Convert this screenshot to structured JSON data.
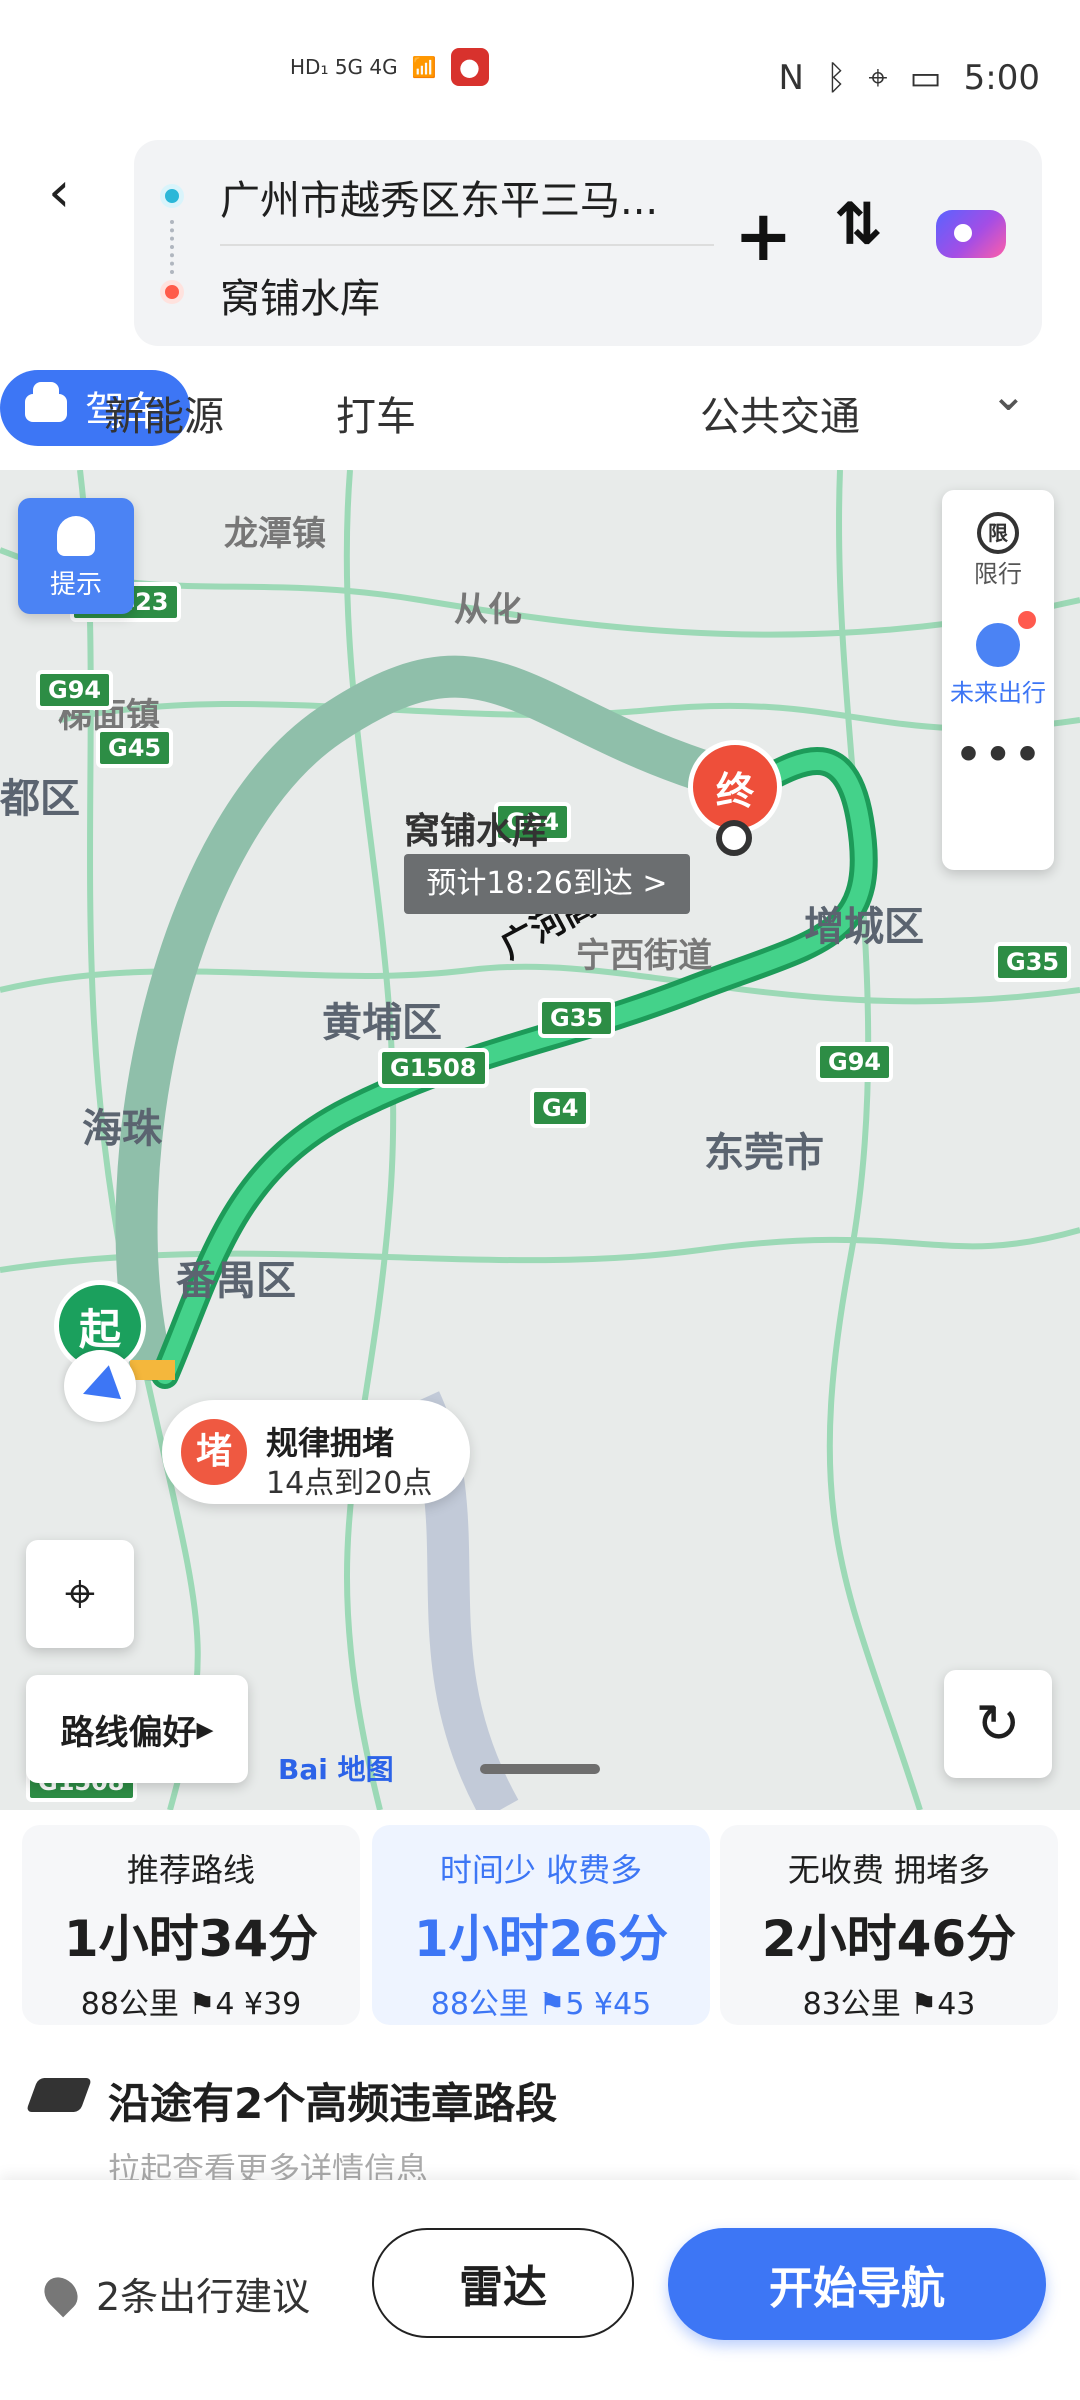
{
  "status": {
    "network": "HD₁ 5G 4G",
    "time": "5:00"
  },
  "search": {
    "from": "广州市越秀区东平三马...",
    "to": "窝铺水库"
  },
  "tabs": [
    "新能源",
    "打车",
    "驾车",
    "公共交通"
  ],
  "map": {
    "alert": "提示",
    "limit": "限行",
    "limit_icon": "限",
    "future": "未来出行",
    "destination": "窝铺水库",
    "eta": "预计18:26到达 >",
    "start": "起",
    "end": "终",
    "traffic_icon": "堵",
    "traffic_title": "规律拥堵",
    "traffic_time": "14点到20点",
    "route_pref": "路线偏好",
    "logo_baidu": "Bai",
    "logo_map": "地图",
    "labels": [
      "龙潭镇",
      "从化",
      "梯面镇",
      "都区",
      "黄埔区",
      "宁西街道",
      "增城区",
      "海珠",
      "东莞市",
      "番禺区",
      "广河高速"
    ],
    "roads": [
      "G0423",
      "G94",
      "G45",
      "G94",
      "G35",
      "G1508",
      "G4",
      "G94",
      "G35",
      "G1508"
    ]
  },
  "routes": [
    {
      "tag": "推荐路线",
      "time": "1小时34分",
      "meta": "88公里 ⚑4 ¥39"
    },
    {
      "tag": "时间少 收费多",
      "time": "1小时26分",
      "meta": "88公里 ⚑5 ¥45"
    },
    {
      "tag": "无收费 拥堵多",
      "time": "2小时46分",
      "meta": "83公里 ⚑43"
    }
  ],
  "violation": {
    "title": "沿途有2个高频违章路段",
    "subtitle": "拉起查看更多详情信息"
  },
  "bottom": {
    "advice": "2条出行建议",
    "radar": "雷达",
    "navigate": "开始导航"
  }
}
